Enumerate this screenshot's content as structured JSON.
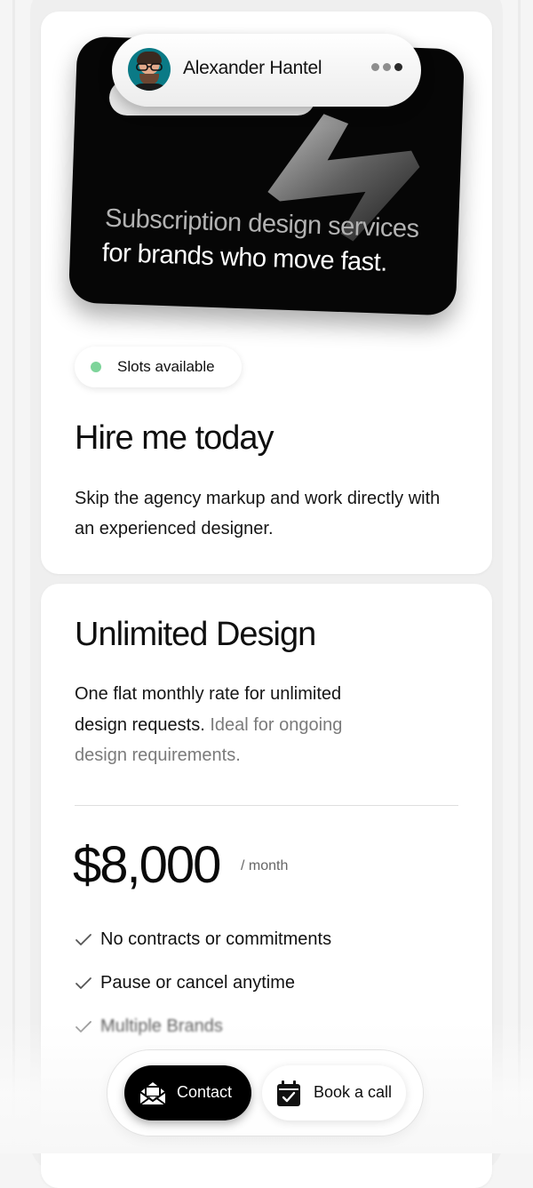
{
  "profile": {
    "name": "Alexander Hantel"
  },
  "hero": {
    "line1": "Subscription design services",
    "line2": "for brands who move fast."
  },
  "availability": {
    "label": "Slots available",
    "dot_color": "#7ed49a"
  },
  "hire": {
    "title": "Hire me today",
    "description": "Skip the agency markup and work directly with an experienced designer."
  },
  "pricing": {
    "title": "Unlimited Design",
    "description_main": "One flat monthly rate for unlimited design requests.",
    "description_muted": "Ideal for ongoing design requirements.",
    "price": "$8,000",
    "period": "/ month",
    "features": [
      "No contracts or commitments",
      "Pause or cancel anytime",
      "Multiple Brands"
    ]
  },
  "actions": {
    "contact_label": "Contact",
    "book_label": "Book a call",
    "contact_icon": "mail-icon",
    "book_icon": "calendar-check-icon"
  },
  "colors": {
    "background": "#f5f5f5",
    "card": "#ffffff",
    "accent_dark": "#000000",
    "muted_text": "#7b7b7b"
  }
}
